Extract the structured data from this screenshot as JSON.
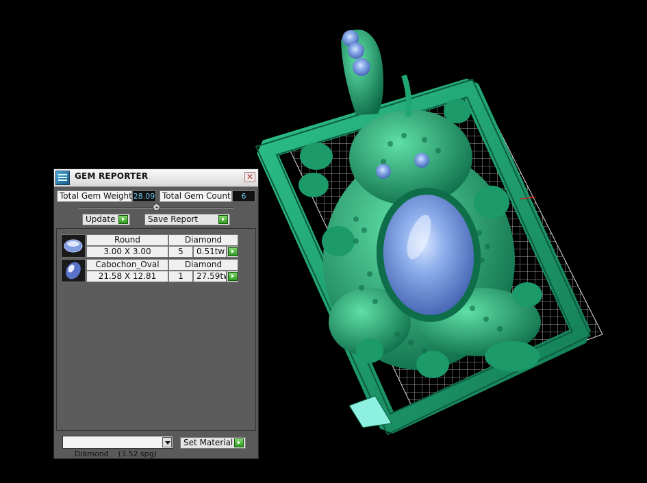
{
  "panel": {
    "title": "GEM REPORTER",
    "close_glyph": "✕",
    "total_weight_label": "Total Gem Weight",
    "total_weight_value": "28.09",
    "total_count_label": "Total Gem Count",
    "total_count_value": "6",
    "update_label": "Update",
    "save_label": "Save Report",
    "gems": [
      {
        "shape": "Round",
        "material": "Diamond",
        "size": "3.00 X 3.00",
        "count": "5",
        "weight": "0.51tw"
      },
      {
        "shape": "Cabochon_Oval",
        "material": "Diamond",
        "size": "21.58 X 12.81",
        "count": "1",
        "weight": "27.59tw"
      }
    ],
    "material_selected": "Diamond    (3.52 spg)",
    "set_material_label": "Set Material"
  },
  "colors": {
    "metal_green": "#1f9a6e",
    "gem_blue": "#6a8ed8",
    "grid": "#d8d8d8",
    "go_button": "#2d9a1f"
  },
  "icons": {
    "app": "gem-reporter-icon",
    "close": "close-icon",
    "go": "play-arrow-icon",
    "dropdown": "chevron-down-icon"
  }
}
